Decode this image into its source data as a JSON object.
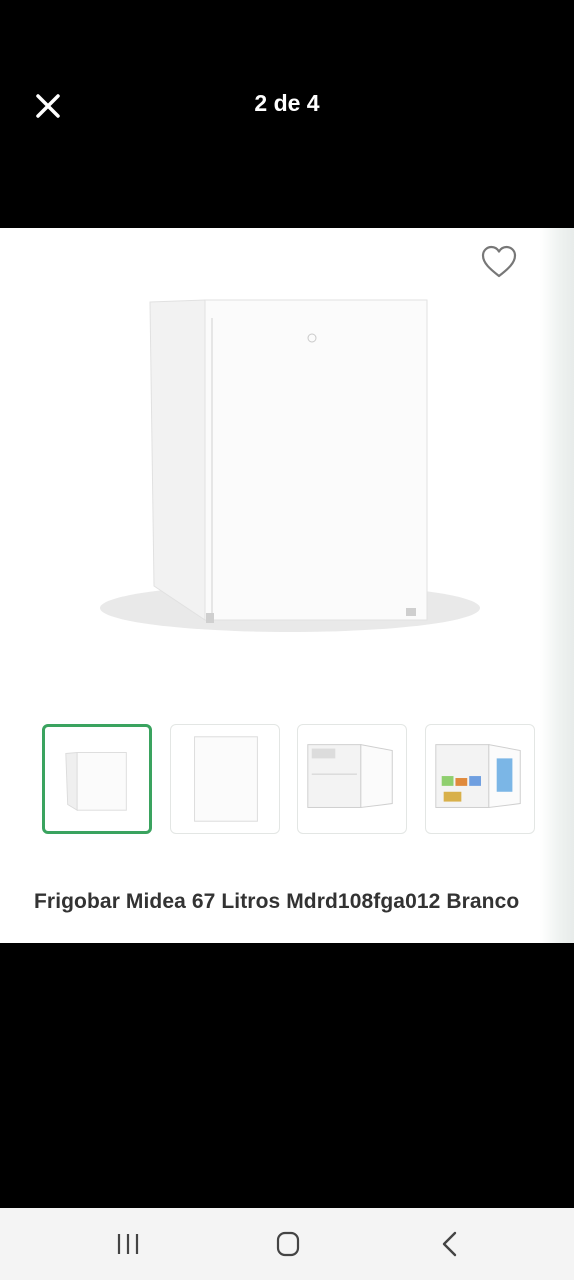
{
  "header": {
    "counter": "2 de 4"
  },
  "product": {
    "title": "Frigobar Midea 67 Litros Mdrd108fga012 Branco",
    "thumbnails": [
      {
        "name": "thumb-fridge-angle",
        "selected": true
      },
      {
        "name": "thumb-fridge-front",
        "selected": false
      },
      {
        "name": "thumb-fridge-open-empty",
        "selected": false
      },
      {
        "name": "thumb-fridge-open-filled",
        "selected": false
      }
    ]
  },
  "colors": {
    "accent": "#3aa35f",
    "background": "#000000",
    "panel": "#ffffff"
  },
  "icons": [
    "close-icon",
    "heart-icon",
    "recent-apps-icon",
    "home-icon",
    "back-icon"
  ]
}
